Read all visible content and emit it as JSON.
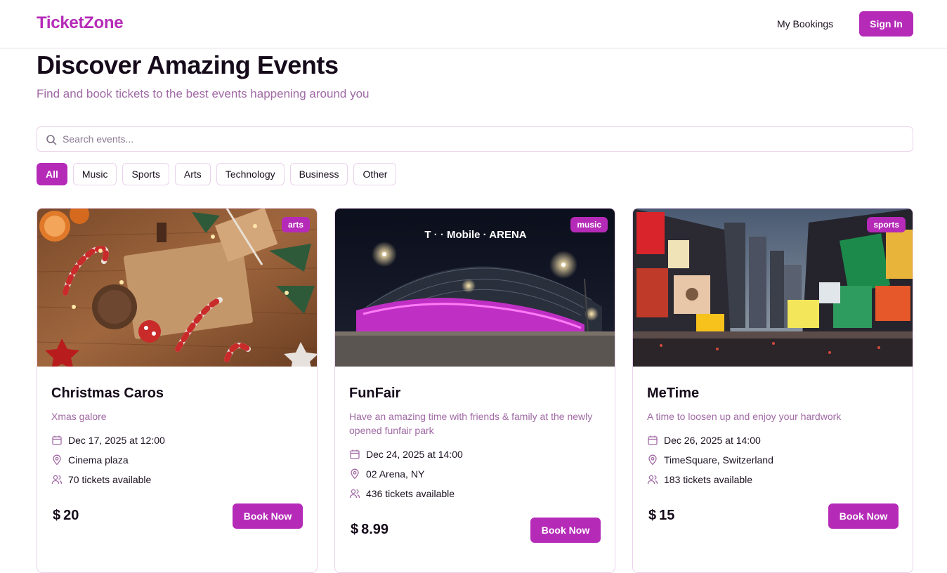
{
  "header": {
    "brand": "TicketZone",
    "my_bookings": "My Bookings",
    "sign_in": "Sign In"
  },
  "hero": {
    "title": "Discover Amazing Events",
    "subtitle": "Find and book tickets to the best events happening around you"
  },
  "search": {
    "placeholder": "Search events...",
    "value": ""
  },
  "filters": [
    "All",
    "Music",
    "Sports",
    "Arts",
    "Technology",
    "Business",
    "Other"
  ],
  "active_filter": "All",
  "events": [
    {
      "category": "arts",
      "title": "Christmas Caros",
      "description": "Xmas galore",
      "datetime": "Dec 17, 2025 at 12:00",
      "location": "Cinema plaza",
      "tickets": "70 tickets available",
      "currency": "$",
      "price": "20",
      "book_label": "Book Now"
    },
    {
      "category": "music",
      "title": "FunFair",
      "description": "Have an amazing time with friends & family at the newly opened funfair park",
      "datetime": "Dec 24, 2025 at 14:00",
      "location": "02 Arena, NY",
      "tickets": "436 tickets available",
      "currency": "$",
      "price": "8.99",
      "book_label": "Book Now",
      "image_sign": "T · · Mobile · ARENA"
    },
    {
      "category": "sports",
      "title": "MeTime",
      "description": "A time to loosen up and enjoy your hardwork",
      "datetime": "Dec 26, 2025 at 14:00",
      "location": "TimeSquare, Switzerland",
      "tickets": "183 tickets available",
      "currency": "$",
      "price": "15",
      "book_label": "Book Now"
    }
  ],
  "icons": {
    "search": "search-icon",
    "calendar": "calendar-icon",
    "location": "map-pin-icon",
    "tickets": "users-icon"
  },
  "colors": {
    "accent": "#b52bb8",
    "muted_text": "#a06aa5",
    "border": "#ead2ec"
  }
}
